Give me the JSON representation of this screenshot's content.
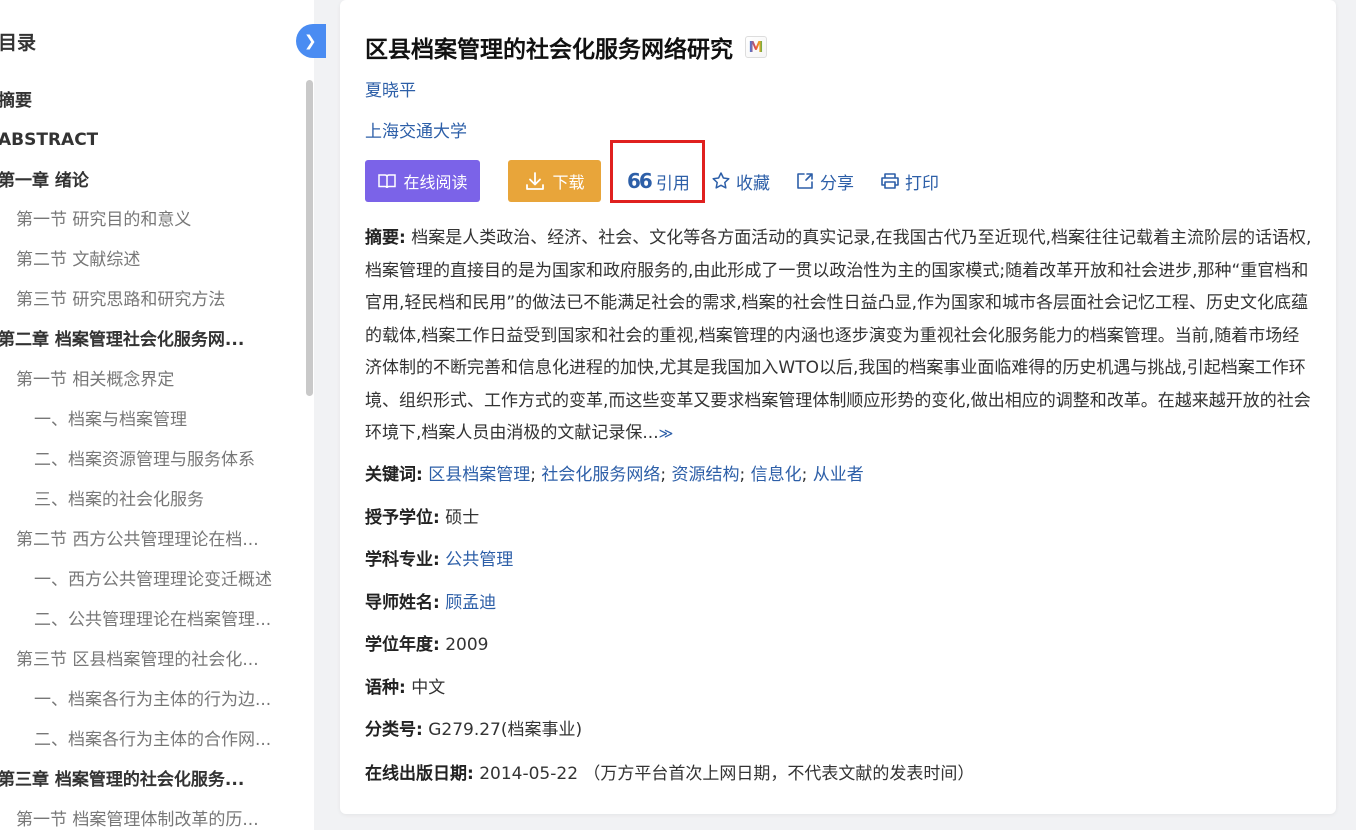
{
  "toc": {
    "title": "目录",
    "collapse_icon": "chevron-right-icon",
    "items": [
      {
        "label": "摘要",
        "level": 0
      },
      {
        "label": "ABSTRACT",
        "level": 0
      },
      {
        "label": "第一章 绪论",
        "level": 0
      },
      {
        "label": "第一节 研究目的和意义",
        "level": 1
      },
      {
        "label": "第二节 文献综述",
        "level": 1
      },
      {
        "label": "第三节 研究思路和研究方法",
        "level": 1
      },
      {
        "label": "第二章 档案管理社会化服务网...",
        "level": 0
      },
      {
        "label": "第一节 相关概念界定",
        "level": 1
      },
      {
        "label": "一、档案与档案管理",
        "level": 2
      },
      {
        "label": "二、档案资源管理与服务体系",
        "level": 2
      },
      {
        "label": "三、档案的社会化服务",
        "level": 2
      },
      {
        "label": "第二节 西方公共管理理论在档...",
        "level": 1
      },
      {
        "label": "一、西方公共管理理论变迁概述",
        "level": 2
      },
      {
        "label": "二、公共管理理论在档案管理...",
        "level": 2
      },
      {
        "label": "第三节 区县档案管理的社会化...",
        "level": 1
      },
      {
        "label": "一、档案各行为主体的行为边...",
        "level": 2
      },
      {
        "label": "二、档案各行为主体的合作网...",
        "level": 2
      },
      {
        "label": "第三章 档案管理的社会化服务...",
        "level": 0
      },
      {
        "label": "第一节 档案管理体制改革的历...",
        "level": 1
      }
    ]
  },
  "paper": {
    "title": "区县档案管理的社会化服务网络研究",
    "badge": "M",
    "author": "夏晓平",
    "institution": "上海交通大学"
  },
  "actions": {
    "read_label": "在线阅读",
    "download_label": "下载",
    "cite_glyph": "66",
    "cite_label": "引用",
    "favorite_label": "收藏",
    "share_label": "分享",
    "print_label": "打印"
  },
  "abstract": {
    "label": "摘要:",
    "text": "档案是人类政治、经济、社会、文化等各方面活动的真实记录,在我国古代乃至近现代,档案往往记载着主流阶层的话语权,档案管理的直接目的是为国家和政府服务的,由此形成了一贯以政治性为主的国家模式;随着改革开放和社会进步,那种“重官档和官用,轻民档和民用”的做法已不能满足社会的需求,档案的社会性日益凸显,作为国家和城市各层面社会记忆工程、历史文化底蕴的载体,档案工作日益受到国家和社会的重视,档案管理的内涵也逐步演变为重视社会化服务能力的档案管理。当前,随着市场经济体制的不断完善和信息化进程的加快,尤其是我国加入WTO以后,我国的档案事业面临难得的历史机遇与挑战,引起档案工作环境、组织形式、工作方式的变革,而这些变革又要求档案管理体制顺应形势的变化,做出相应的调整和改革。在越来越开放的社会环境下,档案人员由消极的文献记录保...",
    "expand_glyph": "≫"
  },
  "meta": {
    "keywords_label": "关键词:",
    "keywords": [
      "区县档案管理",
      "社会化服务网络",
      "资源结构",
      "信息化",
      "从业者"
    ],
    "degree_label": "授予学位:",
    "degree": "硕士",
    "major_label": "学科专业:",
    "major": "公共管理",
    "advisor_label": "导师姓名:",
    "advisor": "顾孟迪",
    "year_label": "学位年度:",
    "year": "2009",
    "language_label": "语种:",
    "language": "中文",
    "class_label": "分类号:",
    "class_no": "G279.27(档案事业)",
    "pubdate_label": "在线出版日期:",
    "pubdate": "2014-05-22",
    "pubdate_note": "（万方平台首次上网日期，不代表文献的发表时间）"
  },
  "colors": {
    "link": "#2d5fa8",
    "read_button": "#7b63e8",
    "download_button": "#e8a53a",
    "highlight_box": "#e0201f",
    "collapse_button": "#4a8cf2"
  }
}
